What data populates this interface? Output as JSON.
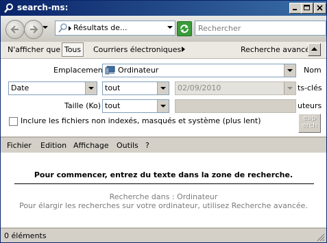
{
  "window": {
    "title": "search-ms:"
  },
  "nav": {
    "address_text": "Résultats de...",
    "search_placeholder": "Rechercher"
  },
  "filters": {
    "label": "N'afficher que :",
    "all_label": "Tous",
    "mail_label": "Courriers électroniques",
    "advanced_label": "Recherche avancée"
  },
  "advanced": {
    "location_label": "Emplacement",
    "location_value": "Ordinateur",
    "name_label": "Nom",
    "date_field_value": "Date",
    "date_operator_value": "tout",
    "date_value": "02/09/2010",
    "tags_label": "ts-clés",
    "size_label": "Taille (Ko)",
    "size_operator_value": "tout",
    "authors_label": "uteurs",
    "include_label": "Inclure les fichiers non indexés, masqués et système (plus lent)",
    "include_checked": false,
    "search_button_line1": "еар",
    "search_button_line2": "erch"
  },
  "menu": {
    "items": [
      "Fichier",
      "Edition",
      "Affichage",
      "Outils",
      "?"
    ]
  },
  "content": {
    "headline": "Pour commencer, entrez du texte dans la zone de recherche.",
    "searching_in": "Recherche dans : Ordinateur",
    "hint": "Pour élargir les recherches sur votre ordinateur, utilisez Recherche avancée."
  },
  "status": {
    "text": "0 éléments"
  }
}
